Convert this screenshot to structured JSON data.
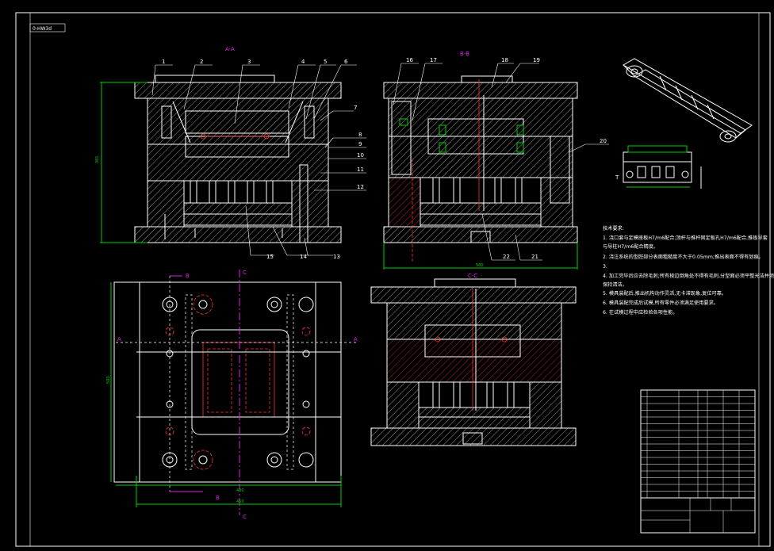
{
  "tag": "0-HW3d",
  "views": {
    "aa_label": "A-A",
    "bb_label": "B-B",
    "cc_label": "C-C"
  },
  "section_marks": {
    "a": "A",
    "b": "B",
    "c": "C"
  },
  "dimensions": {
    "aa_height": "381",
    "bb_width": "580",
    "plan_height": "500",
    "plan_width_inner": "400",
    "plan_width_outer": "450",
    "detail_t": "T"
  },
  "callouts": [
    "1",
    "2",
    "3",
    "4",
    "5",
    "6",
    "7",
    "8",
    "9",
    "10",
    "11",
    "12",
    "13",
    "14",
    "15",
    "16",
    "17",
    "18",
    "19",
    "20",
    "21",
    "22"
  ],
  "notes": {
    "title": "技术要求:",
    "lines": [
      "1. 浇口套与定模座板H7/m6配合;顶杆与推杆固定板孔H7/m6配合,推板导套",
      "与导柱H7/m6配合精度。",
      "2. 浇注系统的型腔部分表面粗糙度不大于0.05mm;推出表面不得有划痕。",
      "3.",
      "4. 加工完毕后应去除毛刺;所有棱边倒角处不得有毛刺,分型面必须平整光洁并须",
      "保持清洁。",
      "5. 模具装配后,推出机构动作灵活,无卡滞现象,复位可靠。",
      "6. 模具装配完成后试模,所有零件必须满足使用要求。",
      "6. 在试模过程中应检验各项性能。"
    ]
  },
  "title_block": {
    "rows": 16,
    "sample": "16"
  },
  "colors": {
    "background": "#000000",
    "line": "#ffffff",
    "accent_red": "#ff3030",
    "accent_green": "#00d000",
    "accent_magenta": "#e020e0"
  }
}
